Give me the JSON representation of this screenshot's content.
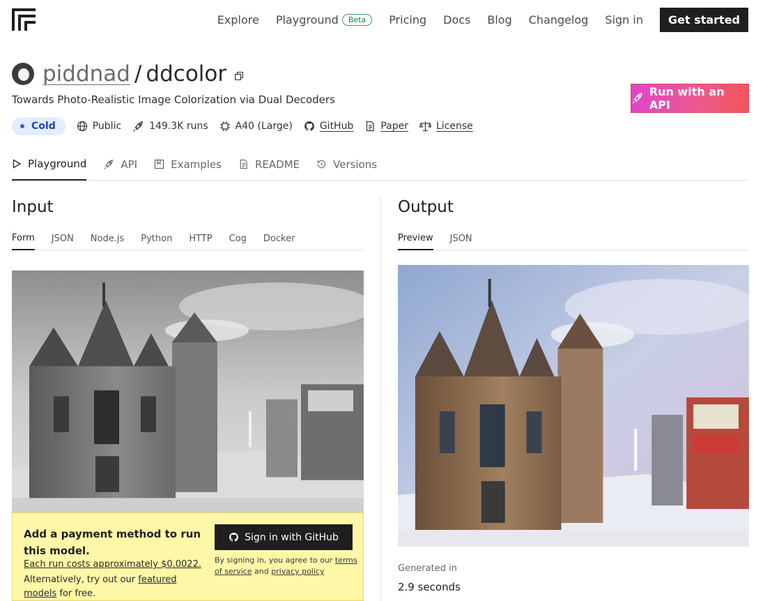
{
  "nav": {
    "links": [
      "Explore",
      "Playground",
      "Pricing",
      "Docs",
      "Blog",
      "Changelog",
      "Sign in"
    ],
    "beta_label": "Beta",
    "cta": "Get started"
  },
  "model": {
    "owner": "piddnad",
    "separator": "/",
    "name": "ddcolor",
    "description": "Towards Photo-Realistic Image Colorization via Dual Decoders",
    "api_button": "Run with an API",
    "status": "Cold",
    "visibility": "Public",
    "runs": "149.3K runs",
    "hardware": "A40 (Large)",
    "github": "GitHub",
    "paper": "Paper",
    "license": "License"
  },
  "tabs": [
    "Playground",
    "API",
    "Examples",
    "README",
    "Versions"
  ],
  "input": {
    "title": "Input",
    "tabs": [
      "Form",
      "JSON",
      "Node.js",
      "Python",
      "HTTP",
      "Cog",
      "Docker"
    ]
  },
  "output": {
    "title": "Output",
    "tabs": [
      "Preview",
      "JSON"
    ],
    "generated_label": "Generated in",
    "generated_value": "2.9 seconds"
  },
  "payment": {
    "title": "Add a payment method to run this model.",
    "cost": "Each run costs approximately $0.0022.",
    "alt_prefix": "Alternatively, try out our",
    "alt_link": "featured models",
    "alt_suffix": "for free.",
    "github_button": "Sign in with GitHub",
    "terms_prefix": "By signing in, you agree to our",
    "terms_link": "terms of service",
    "terms_and": "and",
    "privacy_link": "privacy policy"
  },
  "colors": {
    "accent_gradient_start": "#e046c9",
    "accent_gradient_end": "#f2555a",
    "cold_badge_bg": "#e4ecff",
    "cold_badge_text": "#1d46b8",
    "payment_bg": "#fff7a8",
    "dark": "#1f1f1f"
  }
}
